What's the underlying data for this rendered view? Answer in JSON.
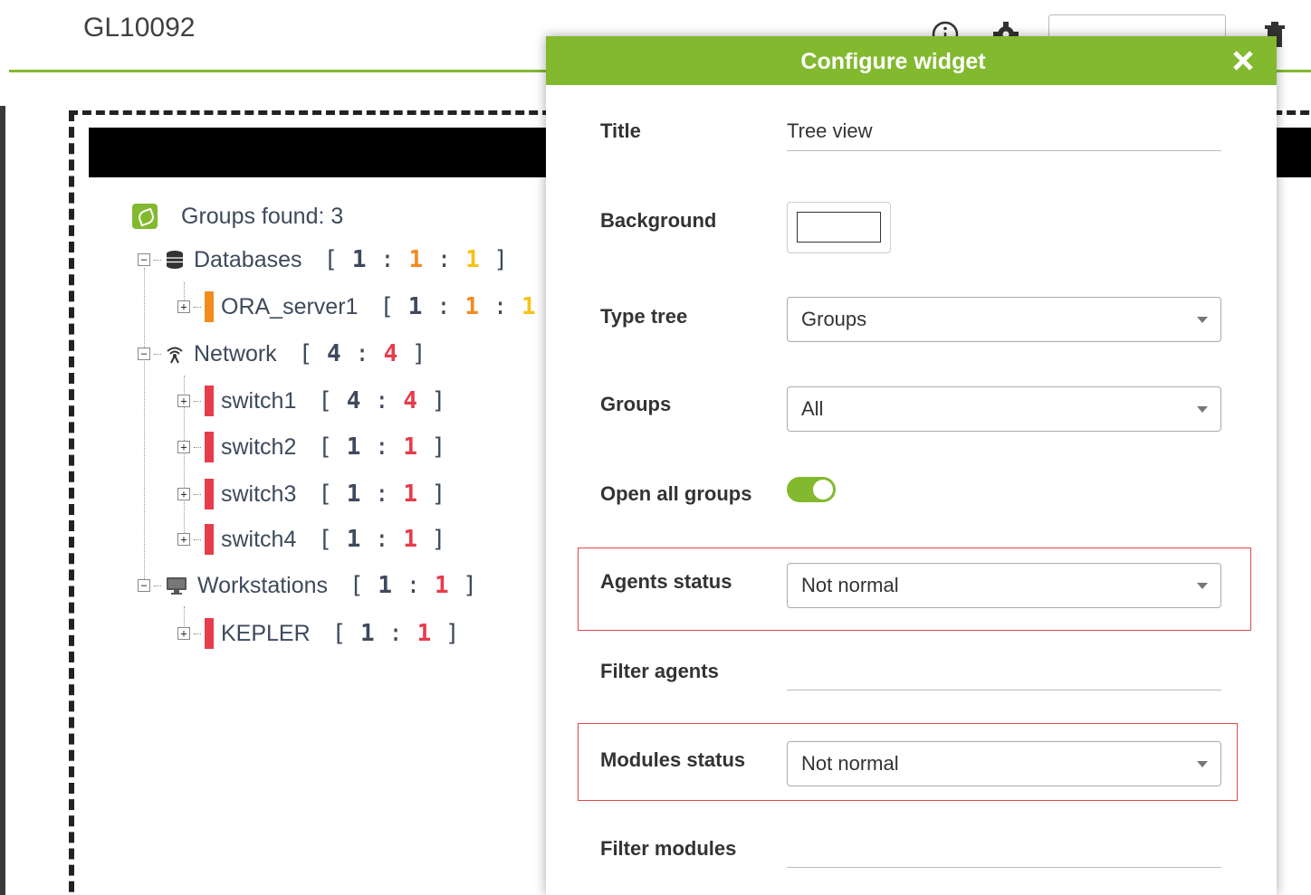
{
  "header": {
    "dashboard_title": "GL10092",
    "icons": [
      "info-icon",
      "gear-icon",
      "trash-icon"
    ]
  },
  "tree": {
    "groups_found": "Groups found: 3",
    "nodes": [
      {
        "label": "Databases",
        "icon": "database-icon",
        "counts": [
          "1",
          "1",
          "1"
        ],
        "count_colors": [
          "#3d4a5c",
          "#f38b1f",
          "#f8c316"
        ]
      },
      {
        "label": "ORA_server1",
        "status_color": "#f38b1f",
        "counts": [
          "1",
          "1",
          "1"
        ],
        "count_colors": [
          "#3d4a5c",
          "#f38b1f",
          "#f8c316"
        ]
      },
      {
        "label": "Network",
        "icon": "antenna-icon",
        "counts": [
          "4",
          "4"
        ],
        "count_colors": [
          "#3d4a5c",
          "#e63c4c"
        ]
      },
      {
        "label": "switch1",
        "status_color": "#e63c4c",
        "counts": [
          "4",
          "4"
        ],
        "count_colors": [
          "#3d4a5c",
          "#e63c4c"
        ]
      },
      {
        "label": "switch2",
        "status_color": "#e63c4c",
        "counts": [
          "1",
          "1"
        ],
        "count_colors": [
          "#3d4a5c",
          "#e63c4c"
        ]
      },
      {
        "label": "switch3",
        "status_color": "#e63c4c",
        "counts": [
          "1",
          "1"
        ],
        "count_colors": [
          "#3d4a5c",
          "#e63c4c"
        ]
      },
      {
        "label": "switch4",
        "status_color": "#e63c4c",
        "counts": [
          "1",
          "1"
        ],
        "count_colors": [
          "#3d4a5c",
          "#e63c4c"
        ]
      },
      {
        "label": "Workstations",
        "icon": "monitor-icon",
        "counts": [
          "1",
          "1"
        ],
        "count_colors": [
          "#3d4a5c",
          "#e63c4c"
        ]
      },
      {
        "label": "KEPLER",
        "status_color": "#e63c4c",
        "counts": [
          "1",
          "1"
        ],
        "count_colors": [
          "#3d4a5c",
          "#e63c4c"
        ]
      }
    ]
  },
  "modal": {
    "title": "Configure widget",
    "close_icon": "close-icon",
    "accent_color": "#82b92e",
    "fields": {
      "title_label": "Title",
      "title_value": "Tree view",
      "background_label": "Background",
      "background_value": "#ffffff",
      "type_tree_label": "Type tree",
      "type_tree_value": "Groups",
      "groups_label": "Groups",
      "groups_value": "All",
      "open_all_label": "Open all groups",
      "open_all_value": true,
      "agents_status_label": "Agents status",
      "agents_status_value": "Not normal",
      "filter_agents_label": "Filter agents",
      "filter_agents_value": "",
      "modules_status_label": "Modules status",
      "modules_status_value": "Not normal",
      "filter_modules_label": "Filter modules",
      "filter_modules_value": ""
    }
  }
}
